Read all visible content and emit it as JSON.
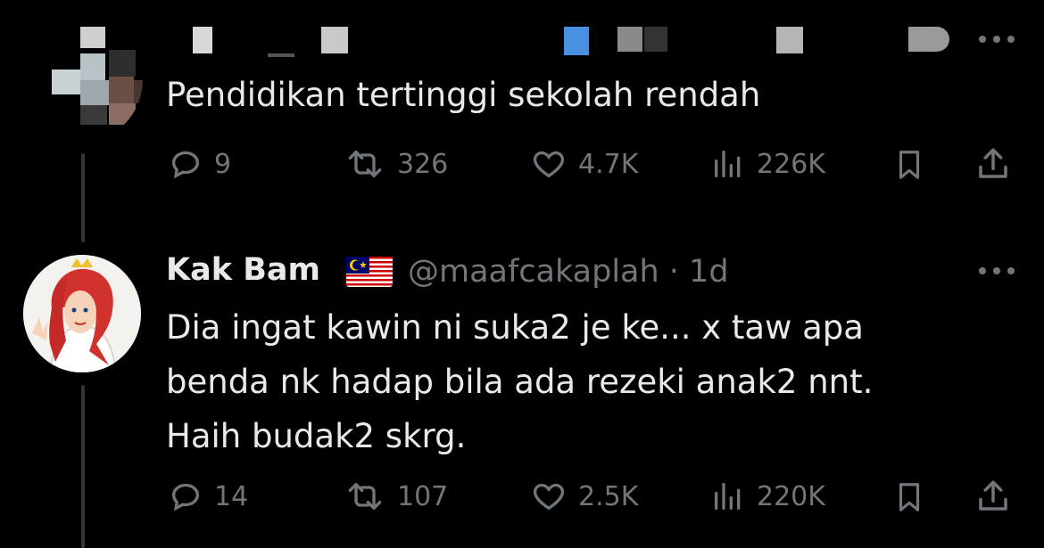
{
  "tweet1": {
    "text": "Pendidikan tertinggi sekolah rendah",
    "actions": {
      "replies": "9",
      "reposts": "326",
      "likes": "4.7K",
      "views": "226K"
    }
  },
  "tweet2": {
    "name": "Kak Bam",
    "flag": "malaysia-flag",
    "handle_time": "@maafcakaplah · 1d",
    "text": "Dia ingat kawin ni suka2 je ke... x taw apa\nbenda nk hadap bila ada rezeki anak2 nnt.\nHaih budak2 skrg.",
    "actions": {
      "replies": "14",
      "reposts": "107",
      "likes": "2.5K",
      "views": "220K"
    }
  },
  "colors": {
    "background": "#000000",
    "text": "#e7e9ea",
    "muted": "#71767b",
    "thread_line": "#333639"
  }
}
